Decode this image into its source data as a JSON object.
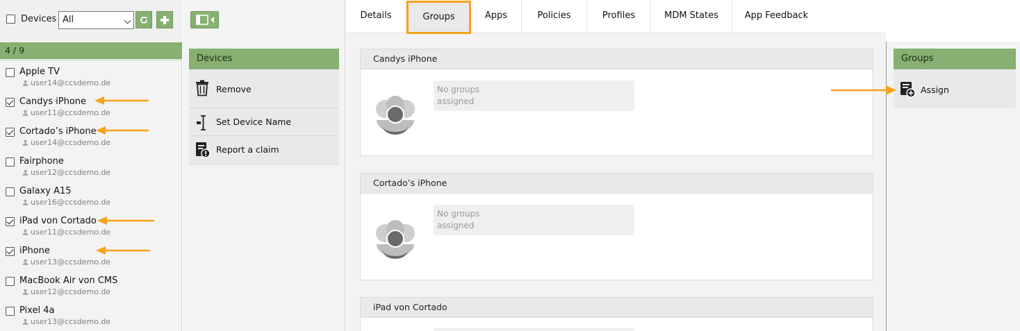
{
  "left": {
    "header": {
      "label": "Devices",
      "filter_value": "All"
    },
    "count": "4 / 9",
    "devices": [
      {
        "name": "Apple TV",
        "user": "user14@ccsdemo.de",
        "checked": false
      },
      {
        "name": "Candys iPhone",
        "user": "user11@ccsdemo.de",
        "checked": true
      },
      {
        "name": "Cortado’s iPhone",
        "user": "user14@ccsdemo.de",
        "checked": true
      },
      {
        "name": "Fairphone",
        "user": "user12@ccsdemo.de",
        "checked": false
      },
      {
        "name": "Galaxy A15",
        "user": "user16@ccsdemo.de",
        "checked": false
      },
      {
        "name": "iPad von Cortado",
        "user": "user11@ccsdemo.de",
        "checked": true
      },
      {
        "name": "iPhone",
        "user": "user13@ccsdemo.de",
        "checked": true
      },
      {
        "name": "MacBook Air von CMS",
        "user": "user12@ccsdemo.de",
        "checked": false
      },
      {
        "name": "Pixel 4a",
        "user": "user13@ccsdemo.de",
        "checked": false
      }
    ],
    "icons": {
      "refresh": "refresh-icon",
      "add": "plus-icon",
      "user": "user-icon"
    }
  },
  "actions": {
    "title": "Devices",
    "items": [
      {
        "label": "Remove",
        "icon": "trash-icon"
      },
      {
        "label": "Set Device Name",
        "icon": "text-cursor-icon"
      },
      {
        "label": "Report a claim",
        "icon": "claim-report-icon"
      }
    ]
  },
  "tabs": [
    {
      "label": "Details",
      "active": false
    },
    {
      "label": "Groups",
      "active": true
    },
    {
      "label": "Apps",
      "active": false
    },
    {
      "label": "Policies",
      "active": false
    },
    {
      "label": "Profiles",
      "active": false
    },
    {
      "label": "MDM States",
      "active": false
    },
    {
      "label": "App Feedback",
      "active": false
    }
  ],
  "cards": [
    {
      "title": "Candys iPhone",
      "empty_text": "No groups\nassigned"
    },
    {
      "title": "Cortado’s iPhone",
      "empty_text": "No groups\nassigned"
    },
    {
      "title": "iPad von Cortado",
      "empty_text": ""
    }
  ],
  "groups_panel": {
    "title": "Groups",
    "assign_label": "Assign",
    "assign_icon": "assign-group-icon"
  },
  "colors": {
    "accent_green": "#87b072",
    "highlight_orange": "#f7a21b",
    "annotation_arrow": "#f7a21b"
  }
}
